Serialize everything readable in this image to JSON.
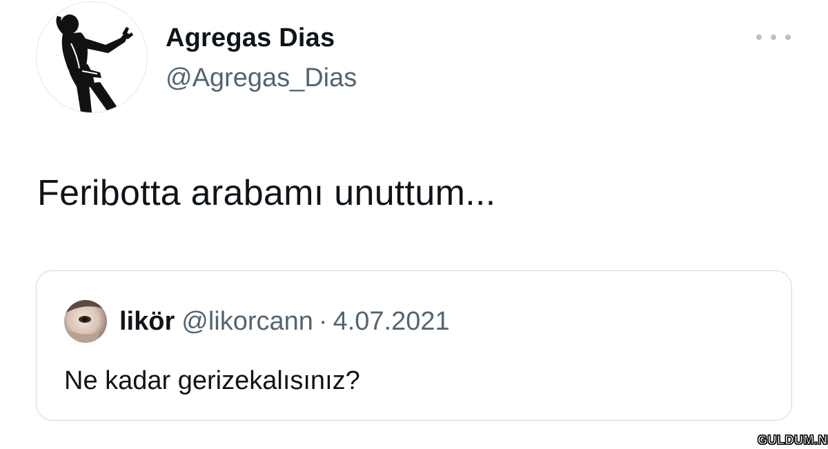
{
  "tweet": {
    "author": {
      "display_name": "Agregas Dias",
      "handle": "@Agregas_Dias",
      "avatar_icon": "dancing-silhouette-icon"
    },
    "more_icon": "more-dots-icon",
    "text": "Feribotta arabamı unuttum..."
  },
  "quote": {
    "author": {
      "display_name": "likör",
      "handle": "@likorcann",
      "avatar_icon": "face-photo-avatar"
    },
    "separator": "·",
    "date": "4.07.2021",
    "text": "Ne kadar gerizekalısınız?"
  },
  "watermark": "GULDUM.NET",
  "colors": {
    "text_primary": "#0f1419",
    "text_secondary": "#536471",
    "border": "#cfd9de",
    "background": "#ffffff"
  }
}
